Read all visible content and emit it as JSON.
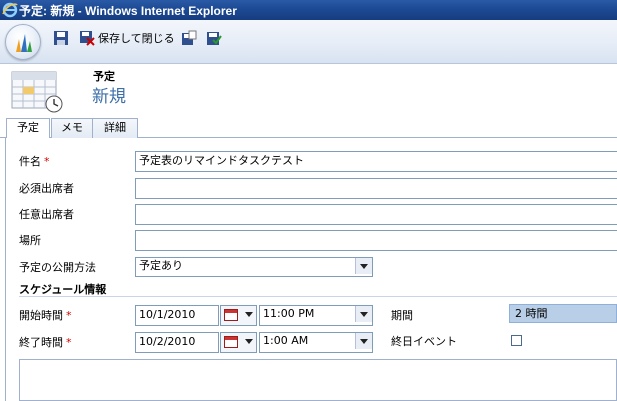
{
  "window": {
    "title": "予定: 新規 - Windows Internet Explorer"
  },
  "toolbar": {
    "save_close_label": "保存して閉じる"
  },
  "header": {
    "entity": "予定",
    "record_title": "新規"
  },
  "tabs": [
    {
      "label": "予定",
      "active": true
    },
    {
      "label": "メモ",
      "active": false
    },
    {
      "label": "詳細",
      "active": false
    }
  ],
  "form": {
    "subject_label": "件名",
    "subject_value": "予定表のリマインドタスクテスト",
    "required_attendees_label": "必須出席者",
    "optional_attendees_label": "任意出席者",
    "location_label": "場所",
    "show_time_as_label": "予定の公開方法",
    "show_time_as_value": "予定あり",
    "required_mark": "*"
  },
  "schedule": {
    "section_title": "スケジュール情報",
    "start_label": "開始時間",
    "start_date": "10/1/2010",
    "start_time": "11:00 PM",
    "end_label": "終了時間",
    "end_date": "10/2/2010",
    "end_time": "1:00 AM",
    "duration_label": "期間",
    "duration_value": "2 時間",
    "all_day_label": "終日イベント",
    "all_day_checked": false
  },
  "colors": {
    "title_bar": "#1d4a94",
    "accent_title": "#3d6fa8",
    "required": "#d00000",
    "duration_fill": "#b9cfe8"
  }
}
